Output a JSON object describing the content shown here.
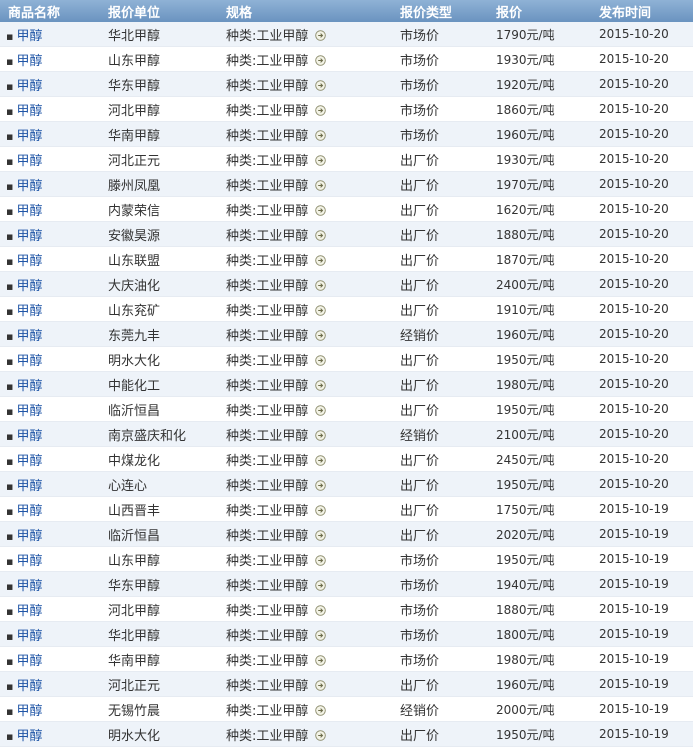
{
  "columns": [
    "商品名称",
    "报价单位",
    "规格",
    "报价类型",
    "报价",
    "发布时间"
  ],
  "rows": [
    {
      "name": "甲醇",
      "unit": "华北甲醇",
      "spec": "种类:工业甲醇",
      "type": "市场价",
      "price": "1790元/吨",
      "date": "2015-10-20"
    },
    {
      "name": "甲醇",
      "unit": "山东甲醇",
      "spec": "种类:工业甲醇",
      "type": "市场价",
      "price": "1930元/吨",
      "date": "2015-10-20"
    },
    {
      "name": "甲醇",
      "unit": "华东甲醇",
      "spec": "种类:工业甲醇",
      "type": "市场价",
      "price": "1920元/吨",
      "date": "2015-10-20"
    },
    {
      "name": "甲醇",
      "unit": "河北甲醇",
      "spec": "种类:工业甲醇",
      "type": "市场价",
      "price": "1860元/吨",
      "date": "2015-10-20"
    },
    {
      "name": "甲醇",
      "unit": "华南甲醇",
      "spec": "种类:工业甲醇",
      "type": "市场价",
      "price": "1960元/吨",
      "date": "2015-10-20"
    },
    {
      "name": "甲醇",
      "unit": "河北正元",
      "spec": "种类:工业甲醇",
      "type": "出厂价",
      "price": "1930元/吨",
      "date": "2015-10-20"
    },
    {
      "name": "甲醇",
      "unit": "滕州凤凰",
      "spec": "种类:工业甲醇",
      "type": "出厂价",
      "price": "1970元/吨",
      "date": "2015-10-20"
    },
    {
      "name": "甲醇",
      "unit": "内蒙荣信",
      "spec": "种类:工业甲醇",
      "type": "出厂价",
      "price": "1620元/吨",
      "date": "2015-10-20"
    },
    {
      "name": "甲醇",
      "unit": "安徽昊源",
      "spec": "种类:工业甲醇",
      "type": "出厂价",
      "price": "1880元/吨",
      "date": "2015-10-20"
    },
    {
      "name": "甲醇",
      "unit": "山东联盟",
      "spec": "种类:工业甲醇",
      "type": "出厂价",
      "price": "1870元/吨",
      "date": "2015-10-20"
    },
    {
      "name": "甲醇",
      "unit": "大庆油化",
      "spec": "种类:工业甲醇",
      "type": "出厂价",
      "price": "2400元/吨",
      "date": "2015-10-20"
    },
    {
      "name": "甲醇",
      "unit": "山东兖矿",
      "spec": "种类:工业甲醇",
      "type": "出厂价",
      "price": "1910元/吨",
      "date": "2015-10-20"
    },
    {
      "name": "甲醇",
      "unit": "东莞九丰",
      "spec": "种类:工业甲醇",
      "type": "经销价",
      "price": "1960元/吨",
      "date": "2015-10-20"
    },
    {
      "name": "甲醇",
      "unit": "明水大化",
      "spec": "种类:工业甲醇",
      "type": "出厂价",
      "price": "1950元/吨",
      "date": "2015-10-20"
    },
    {
      "name": "甲醇",
      "unit": "中能化工",
      "spec": "种类:工业甲醇",
      "type": "出厂价",
      "price": "1980元/吨",
      "date": "2015-10-20"
    },
    {
      "name": "甲醇",
      "unit": "临沂恒昌",
      "spec": "种类:工业甲醇",
      "type": "出厂价",
      "price": "1950元/吨",
      "date": "2015-10-20"
    },
    {
      "name": "甲醇",
      "unit": "南京盛庆和化",
      "spec": "种类:工业甲醇",
      "type": "经销价",
      "price": "2100元/吨",
      "date": "2015-10-20"
    },
    {
      "name": "甲醇",
      "unit": "中煤龙化",
      "spec": "种类:工业甲醇",
      "type": "出厂价",
      "price": "2450元/吨",
      "date": "2015-10-20"
    },
    {
      "name": "甲醇",
      "unit": "心连心",
      "spec": "种类:工业甲醇",
      "type": "出厂价",
      "price": "1950元/吨",
      "date": "2015-10-20"
    },
    {
      "name": "甲醇",
      "unit": "山西晋丰",
      "spec": "种类:工业甲醇",
      "type": "出厂价",
      "price": "1750元/吨",
      "date": "2015-10-19"
    },
    {
      "name": "甲醇",
      "unit": "临沂恒昌",
      "spec": "种类:工业甲醇",
      "type": "出厂价",
      "price": "2020元/吨",
      "date": "2015-10-19"
    },
    {
      "name": "甲醇",
      "unit": "山东甲醇",
      "spec": "种类:工业甲醇",
      "type": "市场价",
      "price": "1950元/吨",
      "date": "2015-10-19"
    },
    {
      "name": "甲醇",
      "unit": "华东甲醇",
      "spec": "种类:工业甲醇",
      "type": "市场价",
      "price": "1940元/吨",
      "date": "2015-10-19"
    },
    {
      "name": "甲醇",
      "unit": "河北甲醇",
      "spec": "种类:工业甲醇",
      "type": "市场价",
      "price": "1880元/吨",
      "date": "2015-10-19"
    },
    {
      "name": "甲醇",
      "unit": "华北甲醇",
      "spec": "种类:工业甲醇",
      "type": "市场价",
      "price": "1800元/吨",
      "date": "2015-10-19"
    },
    {
      "name": "甲醇",
      "unit": "华南甲醇",
      "spec": "种类:工业甲醇",
      "type": "市场价",
      "price": "1980元/吨",
      "date": "2015-10-19"
    },
    {
      "name": "甲醇",
      "unit": "河北正元",
      "spec": "种类:工业甲醇",
      "type": "出厂价",
      "price": "1960元/吨",
      "date": "2015-10-19"
    },
    {
      "name": "甲醇",
      "unit": "无锡竹晨",
      "spec": "种类:工业甲醇",
      "type": "经销价",
      "price": "2000元/吨",
      "date": "2015-10-19"
    },
    {
      "name": "甲醇",
      "unit": "明水大化",
      "spec": "种类:工业甲醇",
      "type": "出厂价",
      "price": "1950元/吨",
      "date": "2015-10-19"
    }
  ],
  "icons": {
    "row_bullet": "bullet-dot",
    "detail": "arrow-circle-icon"
  },
  "colors": {
    "header_bg": "#7ea3cc",
    "link": "#1f55a6",
    "row_alt": "#eef3f9"
  }
}
